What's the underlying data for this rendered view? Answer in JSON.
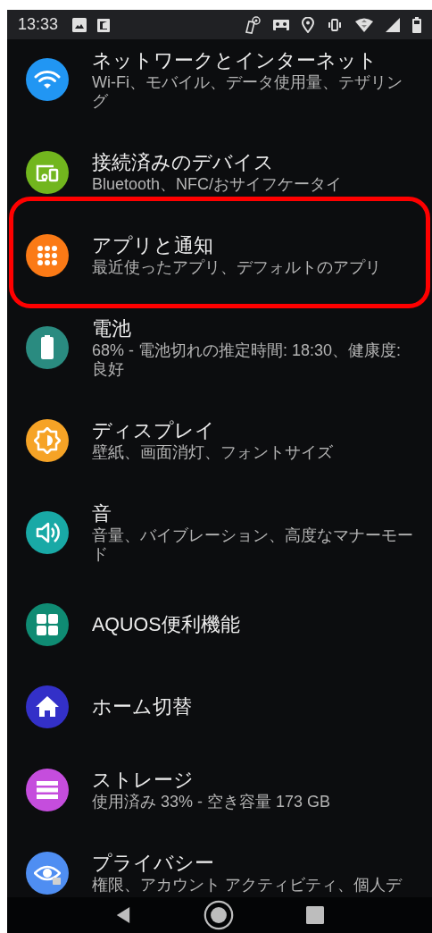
{
  "status_bar": {
    "time": "13:33"
  },
  "items": [
    {
      "title": "ネットワークとインターネット",
      "subtitle": "Wi-Fi、モバイル、データ使用量、テザリング",
      "color": "#2196f3",
      "highlighted": false
    },
    {
      "title": "接続済みのデバイス",
      "subtitle": "Bluetooth、NFC/おサイフケータイ",
      "color": "#72b61e",
      "highlighted": false
    },
    {
      "title": "アプリと通知",
      "subtitle": "最近使ったアプリ、デフォルトのアプリ",
      "color": "#fb7a16",
      "highlighted": true
    },
    {
      "title": "電池",
      "subtitle": "68% - 電池切れの推定時間: 18:30、健康度: 良好",
      "color": "#2a8b80",
      "highlighted": false
    },
    {
      "title": "ディスプレイ",
      "subtitle": "壁紙、画面消灯、フォントサイズ",
      "color": "#f6a326",
      "highlighted": false
    },
    {
      "title": "音",
      "subtitle": "音量、バイブレーション、高度なマナーモード",
      "color": "#19a9a6",
      "highlighted": false
    },
    {
      "title": "AQUOS便利機能",
      "color": "#0f8b73",
      "highlighted": false
    },
    {
      "title": "ホーム切替",
      "color": "#3330c8",
      "highlighted": false
    },
    {
      "title": "ストレージ",
      "subtitle": "使用済み 33% - 空き容量 173 GB",
      "color": "#c54ddd",
      "highlighted": false
    },
    {
      "title": "プライバシー",
      "subtitle": "権限、アカウント アクティビティ、個人デ",
      "color": "#4f8ef2",
      "highlighted": false
    }
  ]
}
